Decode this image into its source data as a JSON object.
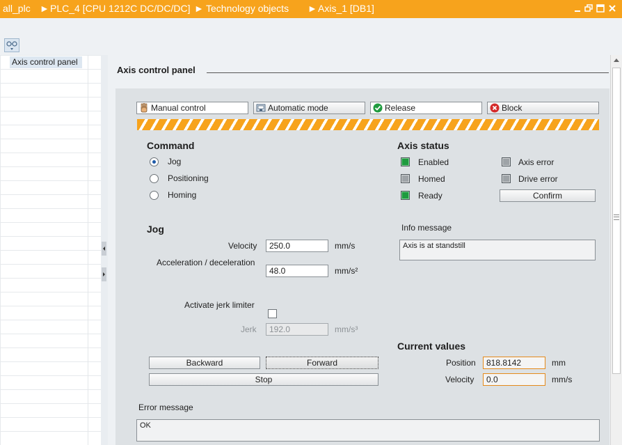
{
  "titlebar": {
    "crumbs": [
      "all_plc",
      "PLC_4 [CPU 1212C DC/DC/DC]",
      "Technology objects",
      "Axis_1 [DB1]"
    ],
    "separator": "►"
  },
  "tree": {
    "selected_item": "Axis control panel"
  },
  "panel": {
    "title": "Axis control panel",
    "mode_buttons": {
      "manual": "Manual control",
      "automatic": "Automatic mode",
      "release": "Release",
      "block": "Block"
    }
  },
  "command": {
    "heading": "Command",
    "options": [
      "Jog",
      "Positioning",
      "Homing"
    ],
    "selected": "Jog"
  },
  "axis_status": {
    "heading": "Axis status",
    "enabled": "Enabled",
    "homed": "Homed",
    "ready": "Ready",
    "axis_error": "Axis error",
    "drive_error": "Drive error",
    "confirm": "Confirm"
  },
  "jog": {
    "heading": "Jog",
    "velocity_label": "Velocity",
    "velocity_value": "250.0",
    "velocity_unit": "mm/s",
    "accel_label": "Acceleration / deceleration",
    "accel_value": "48.0",
    "accel_unit": "mm/s²",
    "jerk_limiter_label": "Activate jerk limiter",
    "jerk_label": "Jerk",
    "jerk_value": "192.0",
    "jerk_unit": "mm/s³",
    "backward": "Backward",
    "forward": "Forward",
    "stop": "Stop"
  },
  "info": {
    "label": "Info message",
    "text": "Axis is at standstill"
  },
  "current_values": {
    "heading": "Current values",
    "position_label": "Position",
    "position_value": "818.8142",
    "position_unit": "mm",
    "velocity_label": "Velocity",
    "velocity_value": "0.0",
    "velocity_unit": "mm/s"
  },
  "error": {
    "label": "Error message",
    "text": "OK"
  },
  "colors": {
    "titlebar": "#f7a31c",
    "status_green": "#1f9b3f",
    "status_gray": "#9ea3a7",
    "field_orange": "#e58a1a"
  }
}
